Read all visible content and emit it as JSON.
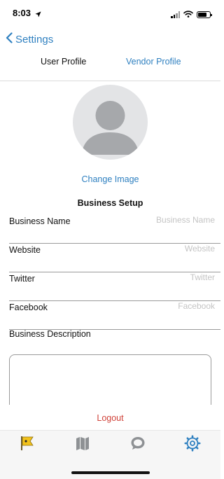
{
  "status_bar": {
    "time": "8:03"
  },
  "nav": {
    "back_label": "Settings"
  },
  "tabs": [
    {
      "label": "User Profile"
    },
    {
      "label": "Vendor Profile"
    }
  ],
  "profile": {
    "change_image_label": "Change Image"
  },
  "section": {
    "title": "Business Setup"
  },
  "fields": [
    {
      "label": "Business Name",
      "placeholder": "Business Name",
      "value": ""
    },
    {
      "label": "Website",
      "placeholder": "Website",
      "value": ""
    },
    {
      "label": "Twitter",
      "placeholder": "Twitter",
      "value": ""
    },
    {
      "label": "Facebook",
      "placeholder": "Facebook",
      "value": ""
    }
  ],
  "description": {
    "label": "Business Description",
    "value": ""
  },
  "logout_label": "Logout",
  "colors": {
    "accent": "#2f80c0",
    "logout": "#d0433a",
    "tab_active": "#2f80c0",
    "tab_inactive": "#8e9194"
  },
  "tabbar": [
    {
      "icon": "flag-icon"
    },
    {
      "icon": "map-icon"
    },
    {
      "icon": "chat-icon"
    },
    {
      "icon": "gear-icon",
      "active": true
    }
  ]
}
